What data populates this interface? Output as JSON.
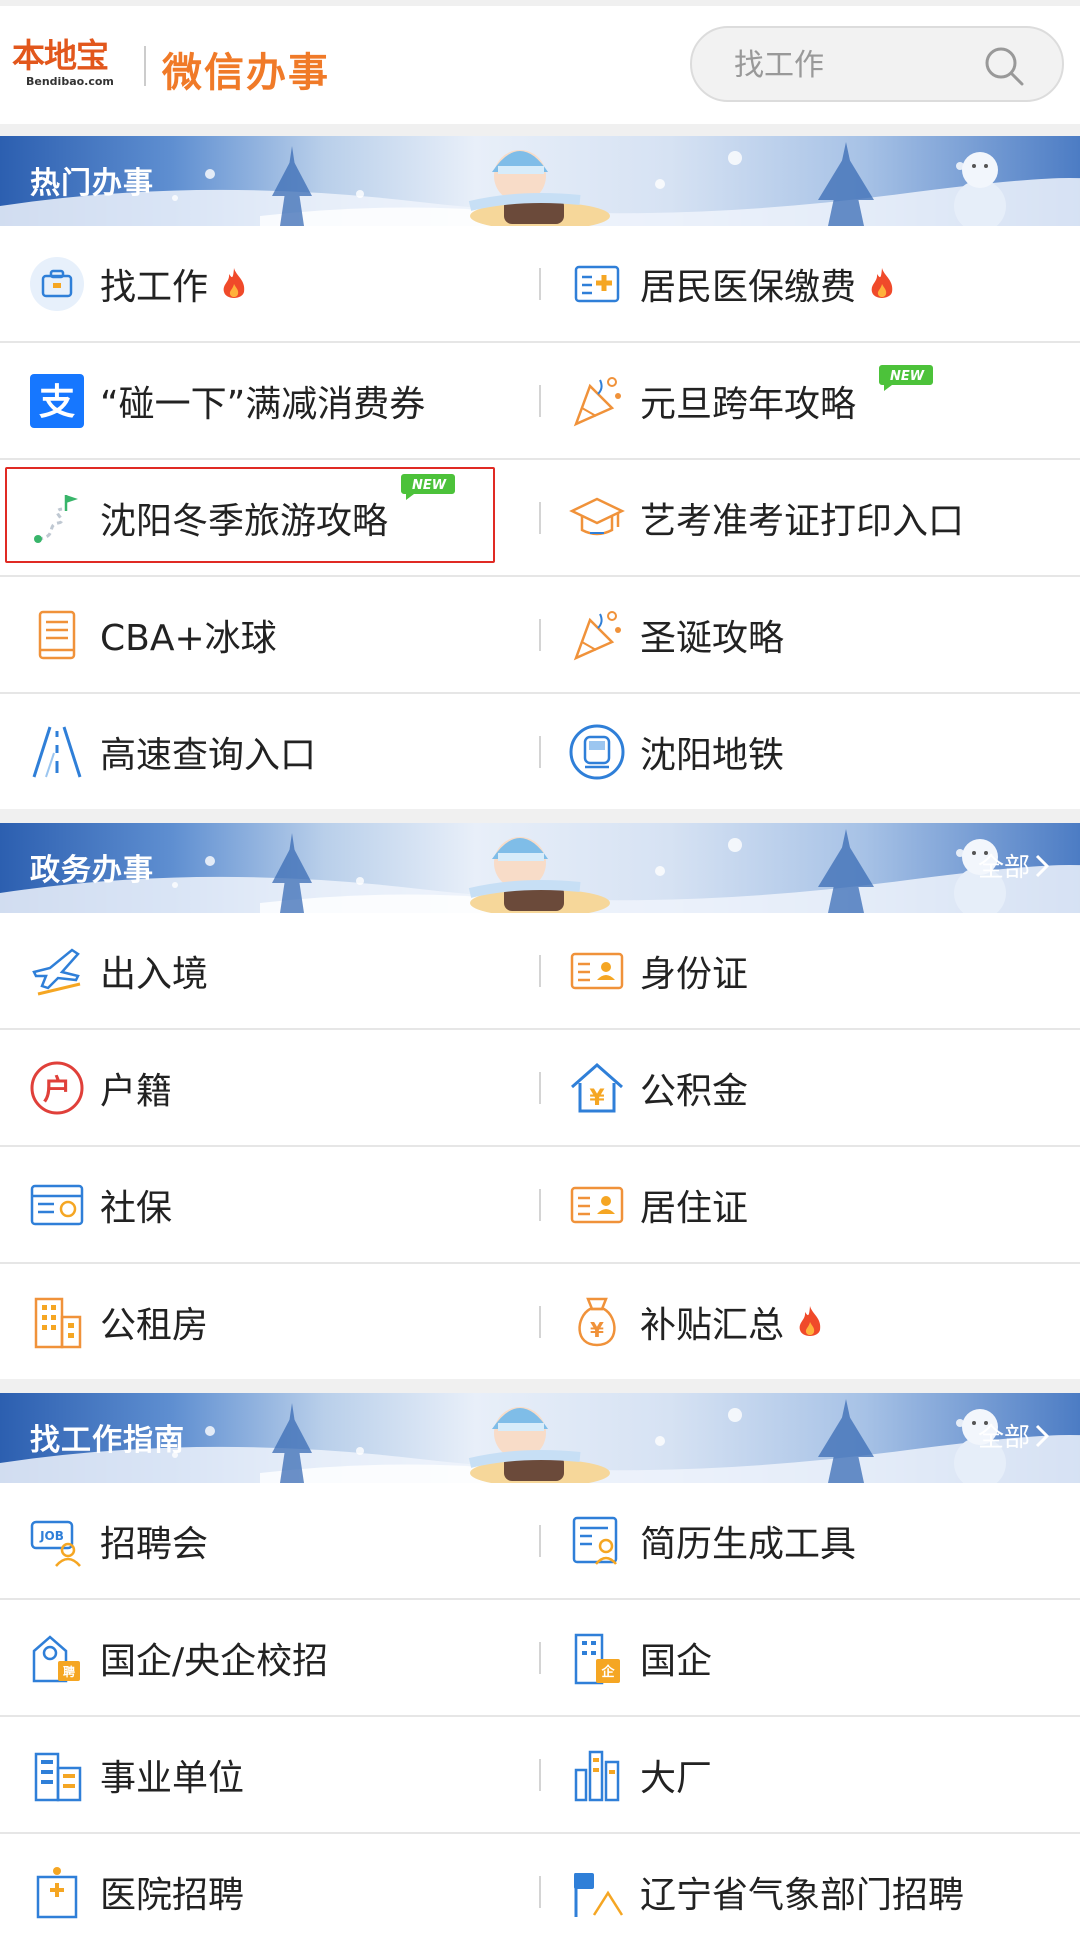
{
  "header": {
    "logo_cn": "本地宝",
    "logo_en": "Bendibao.com",
    "brand_sub": "微信办事",
    "search_placeholder": "找工作"
  },
  "sections": {
    "hot": {
      "title": "热门办事",
      "items": [
        {
          "label": "找工作",
          "icon": "briefcase-icon",
          "hot": true
        },
        {
          "label": "居民医保缴费",
          "icon": "medical-insurance-icon",
          "hot": true
        },
        {
          "label": "“碰一下”满减消费券",
          "icon": "alipay-icon"
        },
        {
          "label": "元旦跨年攻略",
          "icon": "party-popper-icon",
          "new": true
        },
        {
          "label": "沈阳冬季旅游攻略",
          "icon": "route-flag-icon",
          "new": true,
          "highlighted": true
        },
        {
          "label": "艺考准考证打印入口",
          "icon": "graduation-cap-icon"
        },
        {
          "label": "CBA+冰球",
          "icon": "document-icon"
        },
        {
          "label": "圣诞攻略",
          "icon": "party-popper-icon"
        },
        {
          "label": "高速查询入口",
          "icon": "highway-icon"
        },
        {
          "label": "沈阳地铁",
          "icon": "metro-icon"
        }
      ]
    },
    "gov": {
      "title": "政务办事",
      "more": "全部",
      "items": [
        {
          "label": "出入境",
          "icon": "airplane-icon"
        },
        {
          "label": "身份证",
          "icon": "id-card-icon"
        },
        {
          "label": "户籍",
          "icon": "household-icon"
        },
        {
          "label": "公积金",
          "icon": "housing-fund-icon"
        },
        {
          "label": "社保",
          "icon": "social-security-card-icon"
        },
        {
          "label": "居住证",
          "icon": "id-card-icon"
        },
        {
          "label": "公租房",
          "icon": "building-icon"
        },
        {
          "label": "补贴汇总",
          "icon": "money-bag-icon",
          "hot": true
        }
      ]
    },
    "jobs": {
      "title": "找工作指南",
      "more": "全部",
      "items": [
        {
          "label": "招聘会",
          "icon": "job-fair-icon"
        },
        {
          "label": "简历生成工具",
          "icon": "resume-icon"
        },
        {
          "label": "国企/央企校招",
          "icon": "campus-recruit-icon"
        },
        {
          "label": "国企",
          "icon": "state-enterprise-icon"
        },
        {
          "label": "事业单位",
          "icon": "institution-icon"
        },
        {
          "label": "大厂",
          "icon": "big-company-icon"
        },
        {
          "label": "医院招聘",
          "icon": "hospital-icon"
        },
        {
          "label": "辽宁省气象部门招聘",
          "icon": "weather-icon"
        }
      ]
    }
  },
  "badges": {
    "new": "NEW"
  },
  "colors": {
    "brand_orange": "#f07a28",
    "banner_blue": "#2c5fb0",
    "highlight_red": "#e02a24",
    "fire": "#f04a2a"
  }
}
